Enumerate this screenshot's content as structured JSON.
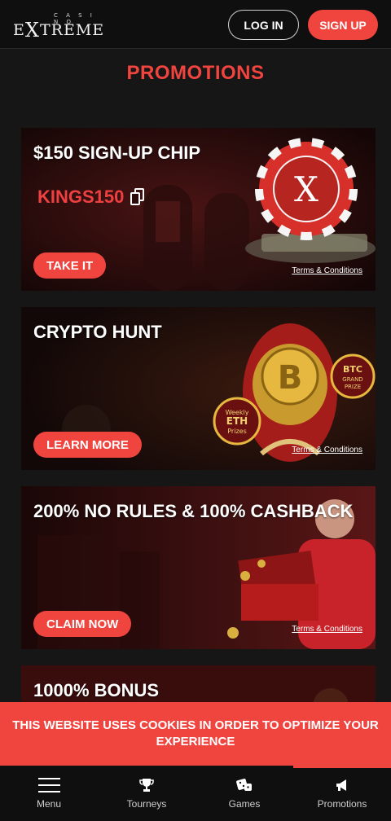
{
  "header": {
    "logo_small": "CASINO",
    "logo_word": "EXTREME",
    "login_label": "LOG IN",
    "signup_label": "SIGN UP"
  },
  "page_title": "PROMOTIONS",
  "cards": [
    {
      "title": "$150 SIGN-UP CHIP",
      "code": "KINGS150",
      "button": "TAKE IT",
      "terms": "Terms & Conditions"
    },
    {
      "title": "CRYPTO HUNT",
      "button": "LEARN MORE",
      "terms": "Terms & Conditions",
      "badges": [
        "Weekly ETH Prizes",
        "BTC GRAND PRIZE"
      ]
    },
    {
      "title": "200% NO RULES & 100% CASHBACK",
      "button": "CLAIM NOW",
      "terms": "Terms & Conditions"
    },
    {
      "title": "1000% BONUS"
    }
  ],
  "cookie_text": "THIS WEBSITE USES COOKIES IN ORDER TO OPTIMIZE YOUR EXPERIENCE",
  "bottom_nav": [
    {
      "label": "Menu",
      "icon": "hamburger-icon"
    },
    {
      "label": "Tourneys",
      "icon": "trophy-icon"
    },
    {
      "label": "Games",
      "icon": "dice-icon"
    },
    {
      "label": "Promotions",
      "icon": "megaphone-icon",
      "active": true
    }
  ],
  "colors": {
    "accent": "#f0443f",
    "background": "#161616",
    "header": "#0f0f0f"
  }
}
